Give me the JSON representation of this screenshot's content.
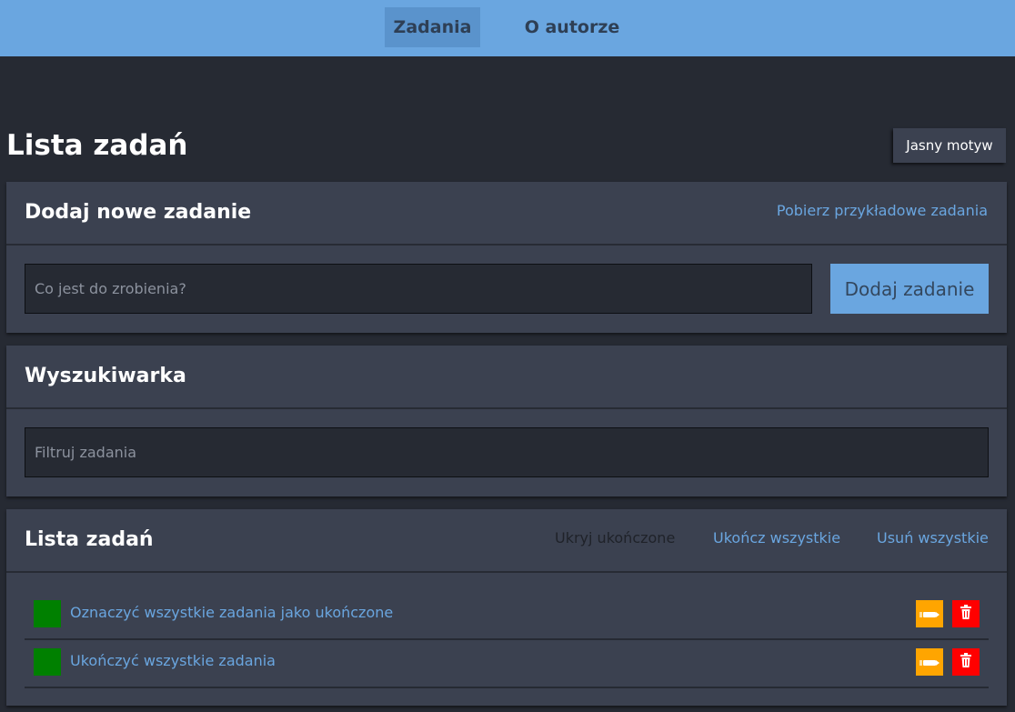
{
  "nav": {
    "items": [
      {
        "label": "Zadania",
        "active": true
      },
      {
        "label": "O autorze",
        "active": false
      }
    ]
  },
  "page": {
    "title": "Lista zadań",
    "theme_button": "Jasny motyw"
  },
  "add_panel": {
    "title": "Dodaj nowe zadanie",
    "sample_link": "Pobierz przykładowe zadania",
    "input_placeholder": "Co jest do zrobienia?",
    "input_value": "",
    "add_button": "Dodaj zadanie"
  },
  "search_panel": {
    "title": "Wyszukiwarka",
    "input_placeholder": "Filtruj zadania",
    "input_value": ""
  },
  "list_panel": {
    "title": "Lista zadań",
    "actions": {
      "hide_completed": "Ukryj ukończone",
      "complete_all": "Ukończ wszystkie",
      "delete_all": "Usuń wszystkie"
    },
    "tasks": [
      {
        "text": "Oznaczyć wszystkie zadania jako ukończone",
        "completed": true
      },
      {
        "text": "Ukończyć wszystkie zadania",
        "completed": true
      }
    ]
  },
  "colors": {
    "accent": "#6aa6e0",
    "background": "#262a33",
    "panel": "#3b4150",
    "done": "#008000",
    "edit": "#ffa500",
    "delete": "#ff0000"
  },
  "icons": {
    "edit": "pencil-icon",
    "delete": "trash-icon"
  }
}
